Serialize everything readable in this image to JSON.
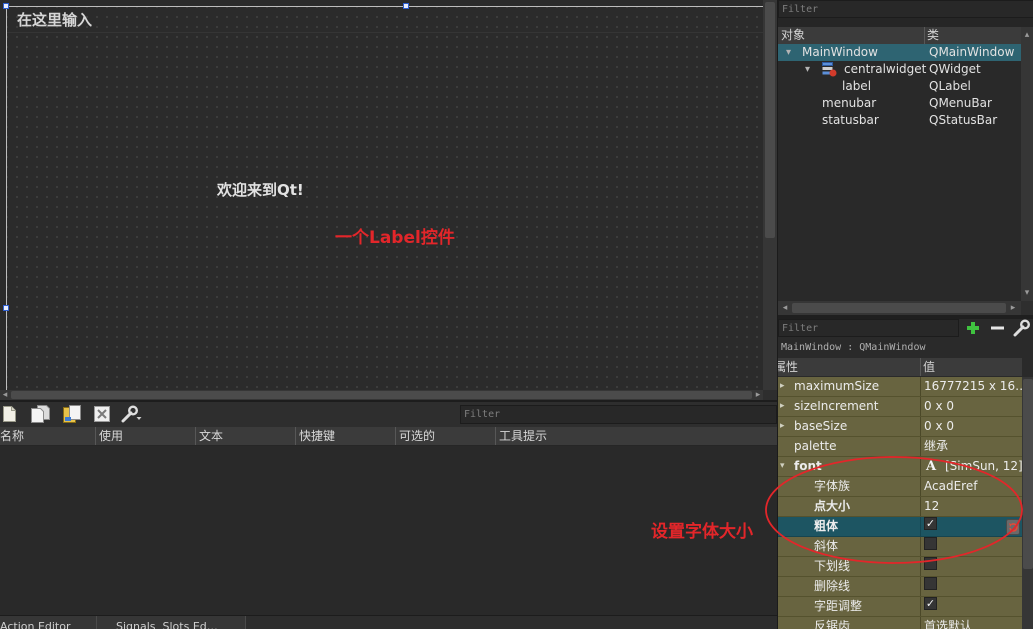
{
  "canvas": {
    "menubar_placeholder": "在这里输入",
    "label_text": "欢迎来到Qt!"
  },
  "annotations": {
    "label_control": "一个Label控件",
    "set_font_size": "设置字体大小"
  },
  "action_editor": {
    "toolbar_icons": [
      "new-file-icon",
      "copy-icon",
      "paste-icon",
      "delete-icon",
      "wrench-icon"
    ],
    "filter_placeholder": "Filter",
    "columns": [
      "名称",
      "使用",
      "文本",
      "快捷键",
      "可选的",
      "工具提示"
    ]
  },
  "bottom_tabs": [
    "Action Editor",
    "Signals  Slots Ed…"
  ],
  "object_inspector": {
    "filter_placeholder": "Filter",
    "header": {
      "object": "对象",
      "class": "类"
    },
    "rows": [
      {
        "name": "MainWindow",
        "class": "QMainWindow",
        "selected": true,
        "expanded": true
      },
      {
        "name": "centralwidget",
        "class": "QWidget",
        "expanded": true,
        "icon": "layout-icon"
      },
      {
        "name": "label",
        "class": "QLabel"
      },
      {
        "name": "menubar",
        "class": "QMenuBar"
      },
      {
        "name": "statusbar",
        "class": "QStatusBar"
      }
    ]
  },
  "property_editor": {
    "filter_placeholder": "Filter",
    "toolbar_icons": [
      "add-icon",
      "remove-icon",
      "wrench-icon"
    ],
    "context": "MainWindow : QMainWindow",
    "header": {
      "property": "属性",
      "value": "值"
    },
    "rows": [
      {
        "name": "maximumSize",
        "value": "16777215 x 16…"
      },
      {
        "name": "sizeIncrement",
        "value": "0 x 0"
      },
      {
        "name": "baseSize",
        "value": "0 x 0"
      },
      {
        "name": "palette",
        "value": "继承"
      },
      {
        "name": "font",
        "value_icon": "A",
        "value": "[SimSun, 12]",
        "modified": true,
        "expanded": true
      },
      {
        "name": "字体族",
        "value": "AcadEref"
      },
      {
        "name": "点大小",
        "value": "12",
        "modified": true
      },
      {
        "name": "粗体",
        "checked": true,
        "modified": true,
        "selected": true
      },
      {
        "name": "斜体",
        "checked": false
      },
      {
        "name": "下划线",
        "checked": false
      },
      {
        "name": "删除线",
        "checked": false
      },
      {
        "name": "字距调整",
        "checked": true
      },
      {
        "name": "反锯齿",
        "value": "首选默认"
      }
    ]
  },
  "colors": {
    "annotation_red": "#e3262a",
    "selection_teal": "#2e6472",
    "property_olive": "#686440",
    "property_selected": "#1d5562"
  }
}
